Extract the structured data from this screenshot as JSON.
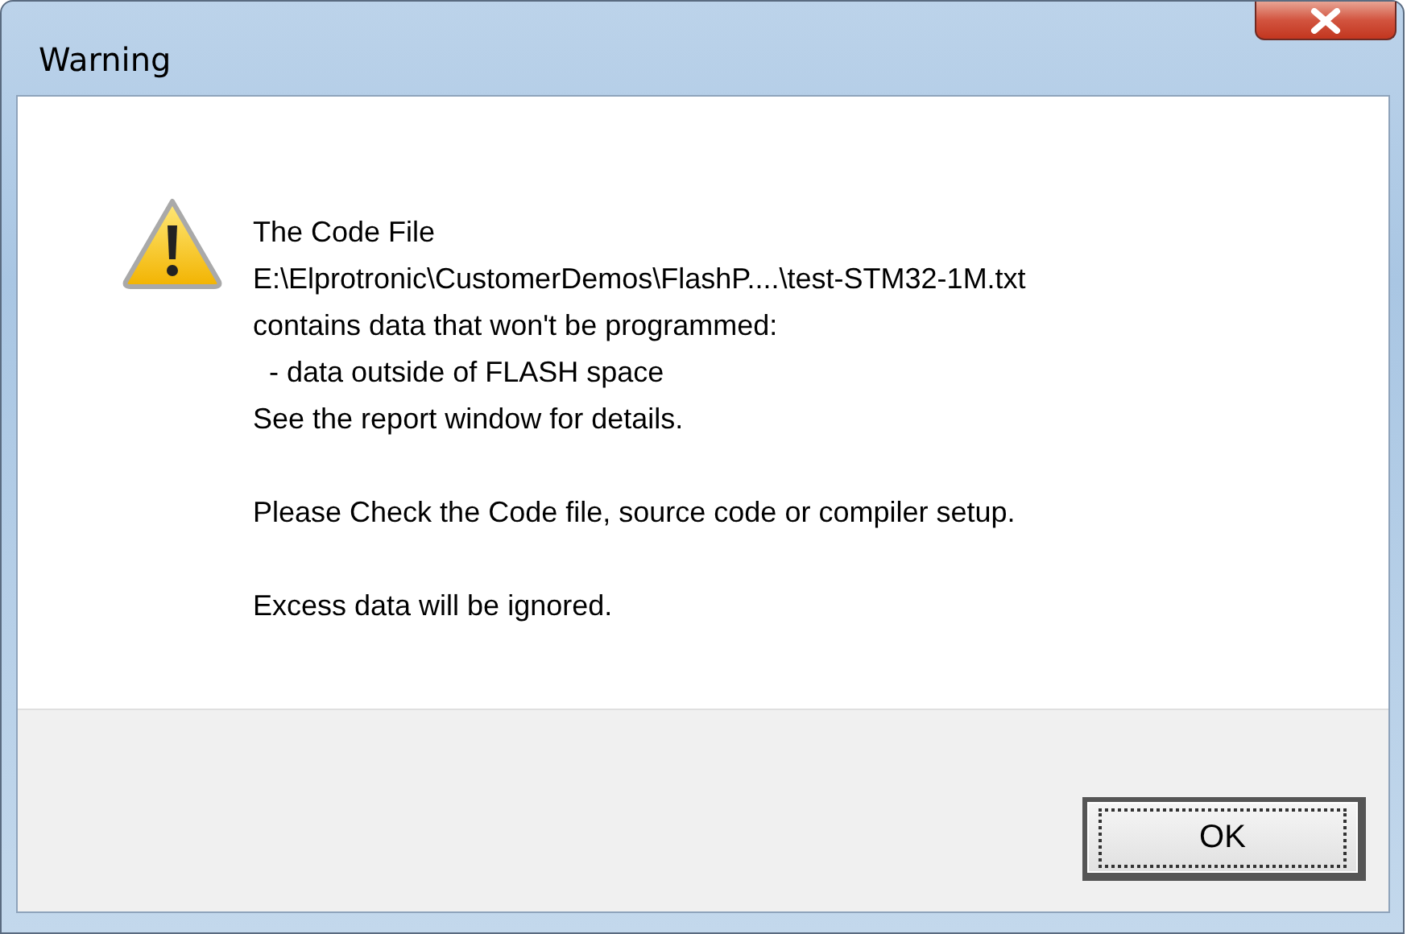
{
  "window": {
    "title": "Warning"
  },
  "message": {
    "paragraphs": [
      {
        "lines": [
          "The Code File",
          "E:\\Elprotronic\\CustomerDemos\\FlashP....\\test-STM32-1M.txt",
          "contains data that won't be programmed:",
          "  - data outside of FLASH space",
          "See the report window for details."
        ]
      },
      {
        "lines": [
          "Please Check the Code file, source code or compiler setup."
        ]
      },
      {
        "lines": [
          "Excess data will be ignored."
        ]
      }
    ]
  },
  "buttons": [
    {
      "label": "OK",
      "default": true
    }
  ]
}
